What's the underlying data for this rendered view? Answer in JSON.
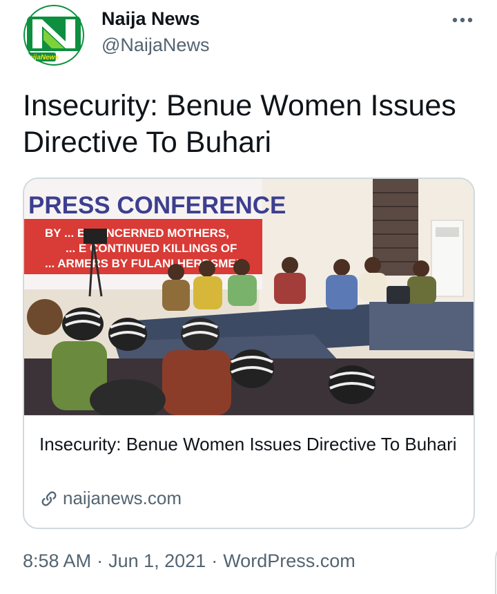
{
  "author": {
    "name": "Naija News",
    "handle": "@NaijaNews",
    "avatar_icon": "naija-news-logo",
    "avatar_logo_text": "NaijaNews",
    "brand_green": "#0d8f3f"
  },
  "more_icon": "more-dots-icon",
  "tweet": {
    "text": "Insecurity: Benue Women Issues Directive To Buhari"
  },
  "card": {
    "image_banner": {
      "headline": "PRESS CONFERENCE",
      "line1": "BY ... E CONCERNED MOTHERS,",
      "line2": "... E CONTINUED KILLINGS OF",
      "line3": "... ARMERS BY FULANI HERDSMEN."
    },
    "title": "Insecurity: Benue Women Issues Directive To Buhari",
    "domain": "naijanews.com",
    "link_icon": "link-icon"
  },
  "meta": {
    "time": "8:58 AM",
    "date": "Jun 1, 2021",
    "source": "WordPress.com",
    "separator": "·"
  },
  "colors": {
    "text_primary": "#0f1419",
    "text_secondary": "#536471",
    "border": "#cfd9de"
  }
}
